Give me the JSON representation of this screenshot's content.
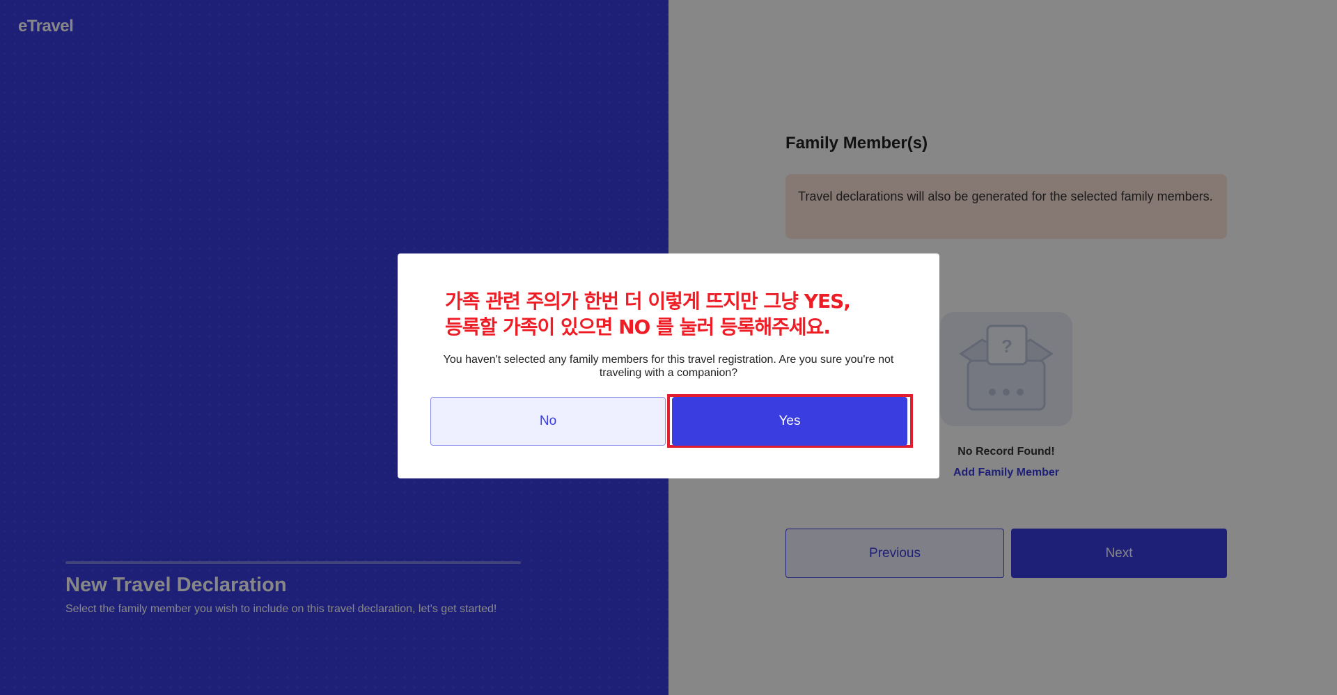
{
  "brand": {
    "logo": "eTravel"
  },
  "hero": {
    "title": "New Travel Declaration",
    "subtitle": "Select the family member you wish to include on this travel declaration, let's get started!"
  },
  "family": {
    "title": "Family Member(s)",
    "info": "Travel declarations will also be generated for the selected family members.",
    "empty_icon": "empty-box-illustration",
    "no_record": "No Record Found!",
    "add_link": "Add Family Member"
  },
  "nav": {
    "previous_label": "Previous",
    "next_label": "Next"
  },
  "modal": {
    "annotation_line1": "가족 관련 주의가 한번 더 이렇게 뜨지만 그냥 YES,",
    "annotation_line2": "등록할 가족이 있으면 NO 를 눌러 등록해주세요.",
    "message": "You haven't selected any family members for this travel registration. Are you sure you're not traveling with a companion?",
    "no_label": "No",
    "yes_label": "Yes"
  },
  "colors": {
    "primary": "#3a3ee0",
    "info_bg": "#fde3d8",
    "annotation_red": "#ee1c25",
    "highlight_border": "#e11d2f"
  }
}
